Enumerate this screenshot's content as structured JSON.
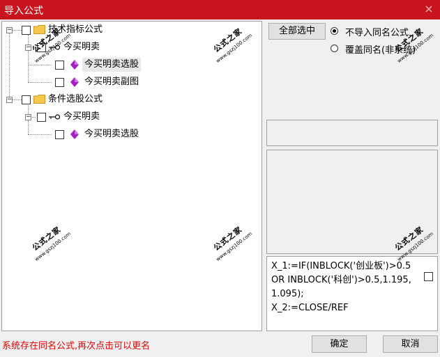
{
  "window": {
    "title": "导入公式",
    "close_glyph": "×"
  },
  "tree": {
    "groups": [
      {
        "label": "技术指标公式",
        "expander": "−",
        "items": [
          {
            "label": "今买明卖",
            "expander": "−",
            "children": [
              {
                "label": "今买明卖选股"
              },
              {
                "label": "今买明卖副图"
              }
            ]
          }
        ]
      },
      {
        "label": "条件选股公式",
        "expander": "−",
        "items": [
          {
            "label": "今买明卖",
            "expander": "−",
            "children": [
              {
                "label": "今买明卖选股"
              }
            ]
          }
        ]
      }
    ]
  },
  "options": {
    "select_all_label": "全部选中",
    "radio_no_import": "不导入同名公式",
    "radio_overwrite": "覆盖同名(非系统)",
    "selected": "no_import"
  },
  "formula_text": "X_1:=IF(INBLOCK('创业板')>0.5 OR INBLOCK('科创')>0.5,1.195,1.095);\nX_2:=CLOSE/REF",
  "status_message": "系统存在同名公式,再次点击可以更名",
  "buttons": {
    "ok": "确定",
    "cancel": "取消"
  },
  "watermark": {
    "title": "公式之家",
    "url": "www.gszj100.com"
  },
  "colors": {
    "titlebar": "#c8141e",
    "status": "#e00000",
    "gem": "#a020c0",
    "folder": "#f5c84c"
  }
}
